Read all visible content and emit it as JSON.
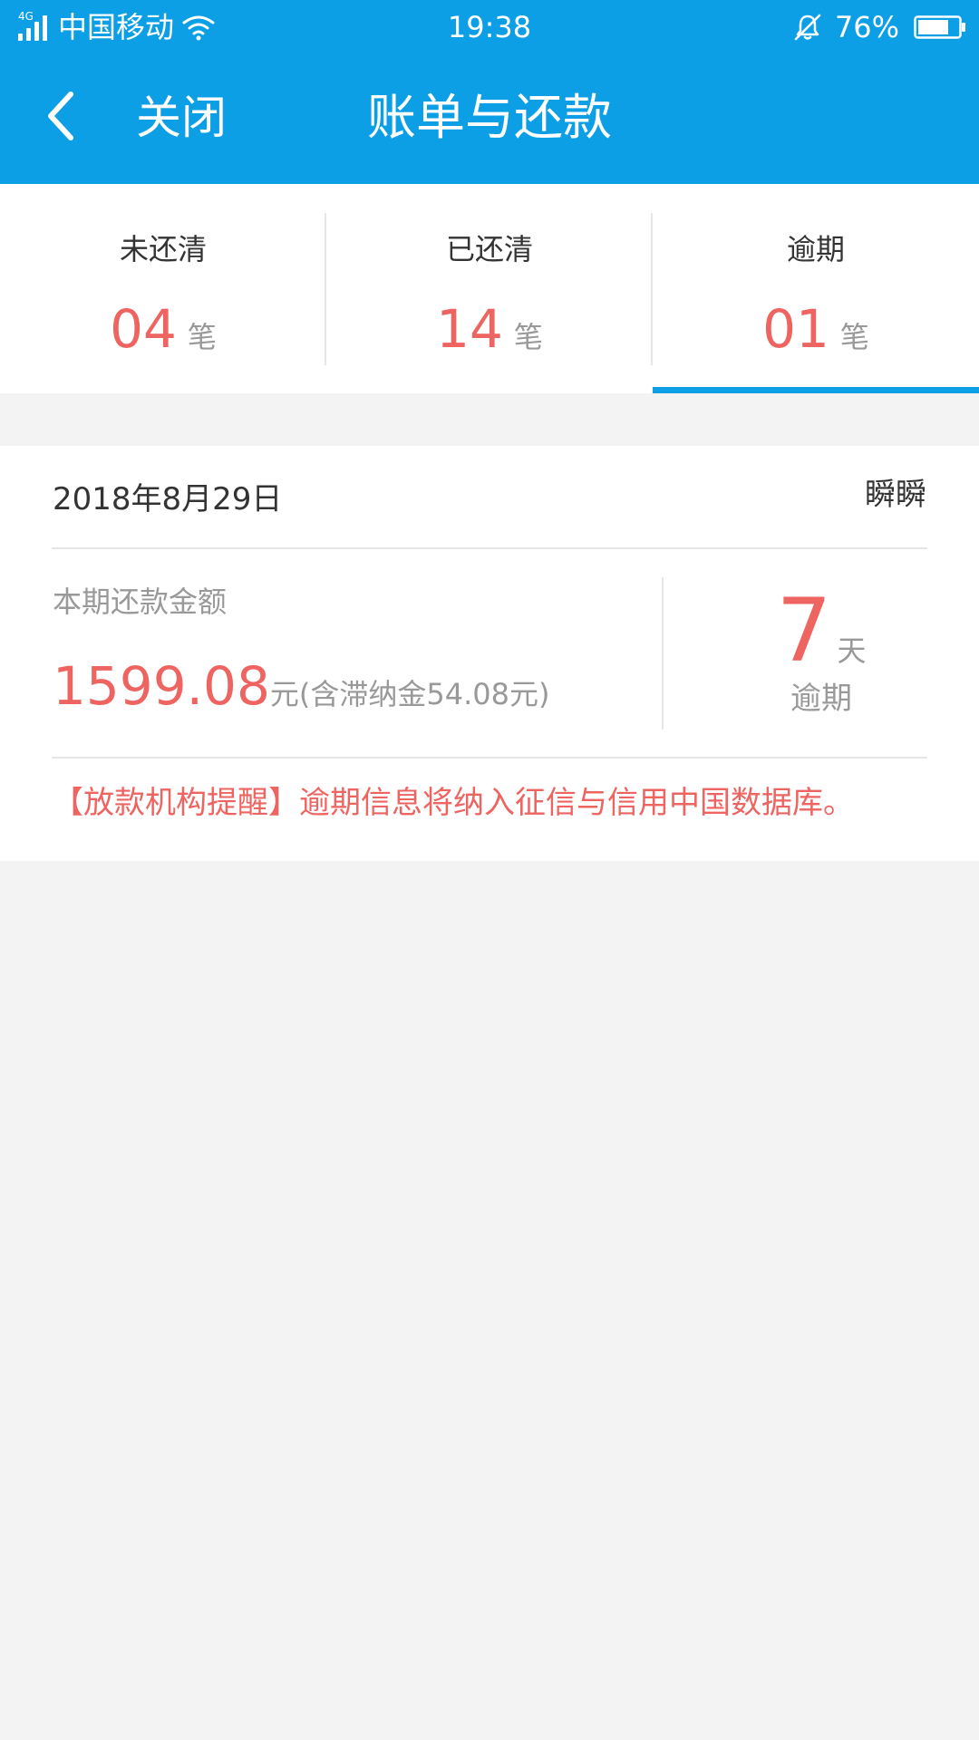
{
  "status_bar": {
    "network": "4G",
    "carrier": "中国移动",
    "time": "19:38",
    "battery_percent": "76%",
    "icons": [
      "signal-icon",
      "wifi-icon",
      "bell-icon",
      "battery-icon"
    ]
  },
  "nav": {
    "back_icon": "chevron-left-icon",
    "close_label": "关闭",
    "title": "账单与还款"
  },
  "tabs": [
    {
      "label": "未还清",
      "count": "04",
      "unit": "笔"
    },
    {
      "label": "已还清",
      "count": "14",
      "unit": "笔"
    },
    {
      "label": "逾期",
      "count": "01",
      "unit": "笔",
      "selected": true
    }
  ],
  "bill": {
    "date": "2018年8月29日",
    "merchant": "瞬瞬",
    "amount_label": "本期还款金额",
    "amount": "1599.08",
    "amount_unit": "元",
    "amount_note": "(含滞纳金54.08元)",
    "overdue_days": "7",
    "overdue_days_unit": "天",
    "overdue_label": "逾期",
    "notice": "【放款机构提醒】逾期信息将纳入征信与信用中国数据库。"
  },
  "colors": {
    "header_bg": "#0c9fe6",
    "accent_red": "#ee6461",
    "page_bg": "#f3f3f3",
    "text_dark": "#333333",
    "text_gray": "#999999"
  }
}
